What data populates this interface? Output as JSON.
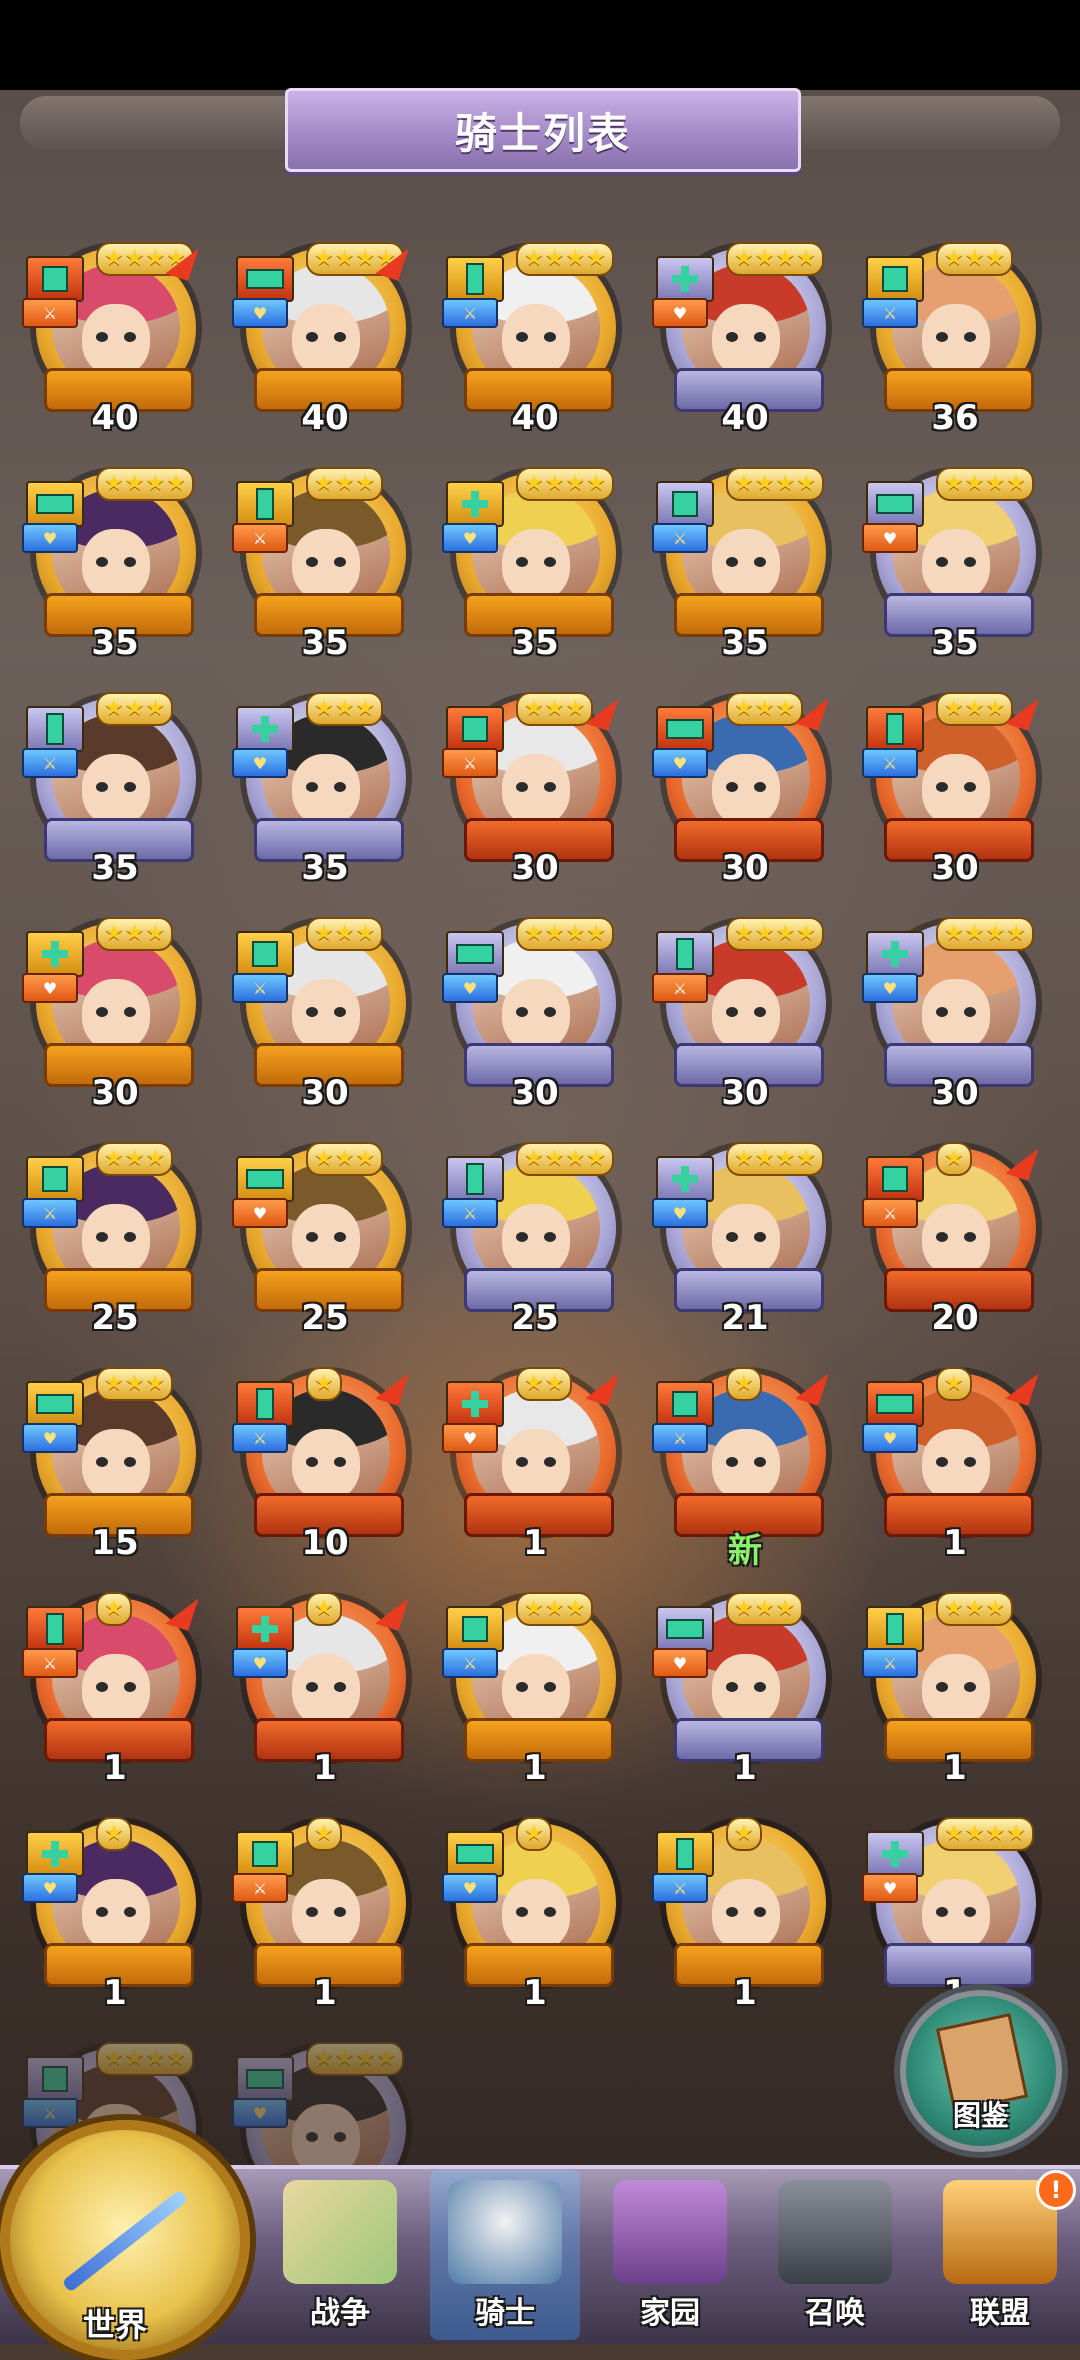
{
  "header": {
    "title": "骑士列表"
  },
  "knights": [
    {
      "level": "40",
      "stars": 4,
      "tier": "red",
      "frame": "gold"
    },
    {
      "level": "40",
      "stars": 4,
      "tier": "red",
      "frame": "gold"
    },
    {
      "level": "40",
      "stars": 4,
      "tier": "gold",
      "frame": "gold"
    },
    {
      "level": "40",
      "stars": 4,
      "tier": "silver",
      "frame": "silver"
    },
    {
      "level": "36",
      "stars": 3,
      "tier": "gold",
      "frame": "gold"
    },
    {
      "level": "35",
      "stars": 4,
      "tier": "gold",
      "frame": "gold"
    },
    {
      "level": "35",
      "stars": 3,
      "tier": "gold",
      "frame": "gold"
    },
    {
      "level": "35",
      "stars": 4,
      "tier": "gold",
      "frame": "gold"
    },
    {
      "level": "35",
      "stars": 4,
      "tier": "silver",
      "frame": "gold"
    },
    {
      "level": "35",
      "stars": 4,
      "tier": "silver",
      "frame": "silver"
    },
    {
      "level": "35",
      "stars": 3,
      "tier": "silver",
      "frame": "silver"
    },
    {
      "level": "35",
      "stars": 3,
      "tier": "silver",
      "frame": "silver"
    },
    {
      "level": "30",
      "stars": 3,
      "tier": "red",
      "frame": "red"
    },
    {
      "level": "30",
      "stars": 3,
      "tier": "red",
      "frame": "red"
    },
    {
      "level": "30",
      "stars": 3,
      "tier": "red",
      "frame": "red"
    },
    {
      "level": "30",
      "stars": 3,
      "tier": "gold",
      "frame": "gold"
    },
    {
      "level": "30",
      "stars": 3,
      "tier": "gold",
      "frame": "gold"
    },
    {
      "level": "30",
      "stars": 4,
      "tier": "silver",
      "frame": "silver"
    },
    {
      "level": "30",
      "stars": 4,
      "tier": "silver",
      "frame": "silver"
    },
    {
      "level": "30",
      "stars": 4,
      "tier": "silver",
      "frame": "silver"
    },
    {
      "level": "25",
      "stars": 3,
      "tier": "gold",
      "frame": "gold"
    },
    {
      "level": "25",
      "stars": 3,
      "tier": "gold",
      "frame": "gold"
    },
    {
      "level": "25",
      "stars": 4,
      "tier": "silver",
      "frame": "silver"
    },
    {
      "level": "21",
      "stars": 4,
      "tier": "silver",
      "frame": "silver"
    },
    {
      "level": "20",
      "stars": 1,
      "tier": "red",
      "frame": "red"
    },
    {
      "level": "15",
      "stars": 3,
      "tier": "gold",
      "frame": "gold"
    },
    {
      "level": "10",
      "stars": 1,
      "tier": "red",
      "frame": "red"
    },
    {
      "level": "1",
      "stars": 2,
      "tier": "red",
      "frame": "red"
    },
    {
      "level": "新",
      "stars": 1,
      "tier": "red",
      "frame": "red",
      "isNew": true
    },
    {
      "level": "1",
      "stars": 1,
      "tier": "red",
      "frame": "red"
    },
    {
      "level": "1",
      "stars": 1,
      "tier": "red",
      "frame": "red"
    },
    {
      "level": "1",
      "stars": 1,
      "tier": "red",
      "frame": "red"
    },
    {
      "level": "1",
      "stars": 3,
      "tier": "gold",
      "frame": "gold"
    },
    {
      "level": "1",
      "stars": 3,
      "tier": "silver",
      "frame": "silver"
    },
    {
      "level": "1",
      "stars": 3,
      "tier": "gold",
      "frame": "gold"
    },
    {
      "level": "1",
      "stars": 1,
      "tier": "gold",
      "frame": "gold"
    },
    {
      "level": "1",
      "stars": 1,
      "tier": "gold",
      "frame": "gold"
    },
    {
      "level": "1",
      "stars": 1,
      "tier": "gold",
      "frame": "gold"
    },
    {
      "level": "1",
      "stars": 1,
      "tier": "gold",
      "frame": "gold"
    },
    {
      "level": "1",
      "stars": 4,
      "tier": "silver",
      "frame": "silver"
    },
    {
      "level": "",
      "stars": 4,
      "tier": "silver",
      "frame": "silver",
      "faded": true
    },
    {
      "level": "",
      "stars": 4,
      "tier": "silver",
      "frame": "silver",
      "faded": true
    }
  ],
  "gallery": {
    "label": "图鉴"
  },
  "nav": {
    "world": "世界",
    "items": [
      "战争",
      "骑士",
      "家园",
      "召唤",
      "联盟"
    ],
    "active_index": 1,
    "alert": "!"
  }
}
